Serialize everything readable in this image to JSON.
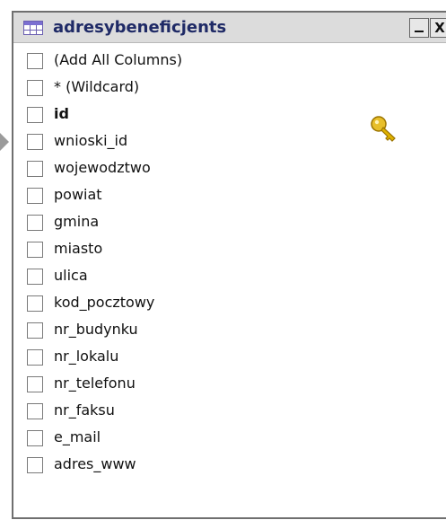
{
  "window": {
    "title": "adresybeneficjents",
    "minimize_label": "_",
    "close_label": "X"
  },
  "columns": [
    {
      "label": "(Add All Columns)",
      "bold": false
    },
    {
      "label": "* (Wildcard)",
      "bold": false
    },
    {
      "label": "id",
      "bold": true,
      "primary_key": true
    },
    {
      "label": "wnioski_id",
      "bold": false
    },
    {
      "label": "wojewodztwo",
      "bold": false
    },
    {
      "label": "powiat",
      "bold": false
    },
    {
      "label": "gmina",
      "bold": false
    },
    {
      "label": "miasto",
      "bold": false
    },
    {
      "label": "ulica",
      "bold": false
    },
    {
      "label": "kod_pocztowy",
      "bold": false
    },
    {
      "label": "nr_budynku",
      "bold": false
    },
    {
      "label": "nr_lokalu",
      "bold": false
    },
    {
      "label": "nr_telefonu",
      "bold": false
    },
    {
      "label": "nr_faksu",
      "bold": false
    },
    {
      "label": "e_mail",
      "bold": false
    },
    {
      "label": "adres_www",
      "bold": false
    }
  ],
  "icons": {
    "table_icon": "table-icon",
    "key_icon": "key-icon",
    "pin_arrow": "pin-arrow-icon"
  },
  "colors": {
    "title_text": "#1f2a66",
    "titlebar_bg": "#dcdcdc",
    "key_gold": "#e0b300"
  }
}
